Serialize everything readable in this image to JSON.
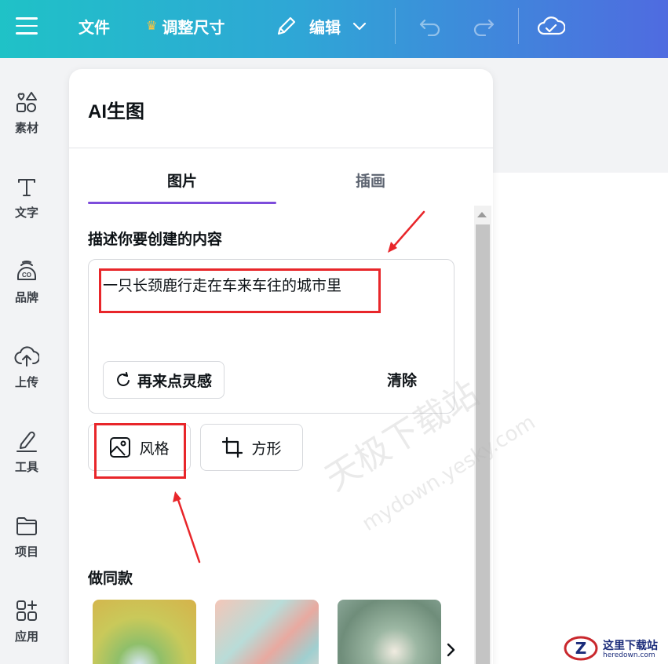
{
  "topbar": {
    "file_label": "文件",
    "resize_label": "调整尺寸",
    "edit_label": "编辑"
  },
  "leftnav": {
    "items": [
      {
        "label": "素材",
        "icon": "elements-icon"
      },
      {
        "label": "文字",
        "icon": "text-icon"
      },
      {
        "label": "品牌",
        "icon": "brand-icon"
      },
      {
        "label": "上传",
        "icon": "upload-icon"
      },
      {
        "label": "工具",
        "icon": "tools-icon"
      },
      {
        "label": "项目",
        "icon": "folder-icon"
      },
      {
        "label": "应用",
        "icon": "apps-icon"
      }
    ]
  },
  "panel": {
    "title": "AI生图",
    "tabs": [
      {
        "label": "图片",
        "active": true
      },
      {
        "label": "插画",
        "active": false
      }
    ],
    "prompt_section_label": "描述你要创建的内容",
    "prompt_value": "一只长颈鹿行走在车来车往的城市里",
    "inspire_label": "再来点灵感",
    "clear_label": "清除",
    "style_label": "风格",
    "shape_label": "方形",
    "same_style_label": "做同款"
  },
  "watermark": {
    "line1": "天极下载站",
    "line2": "mydown.yesky.com"
  },
  "logo": {
    "title": "这里下载站",
    "sub": "heredown.com"
  },
  "colors": {
    "accent": "#7d4cdb",
    "annotation_red": "#e8262a",
    "topbar_start": "#1fc2c7",
    "topbar_end": "#4f6be0"
  }
}
